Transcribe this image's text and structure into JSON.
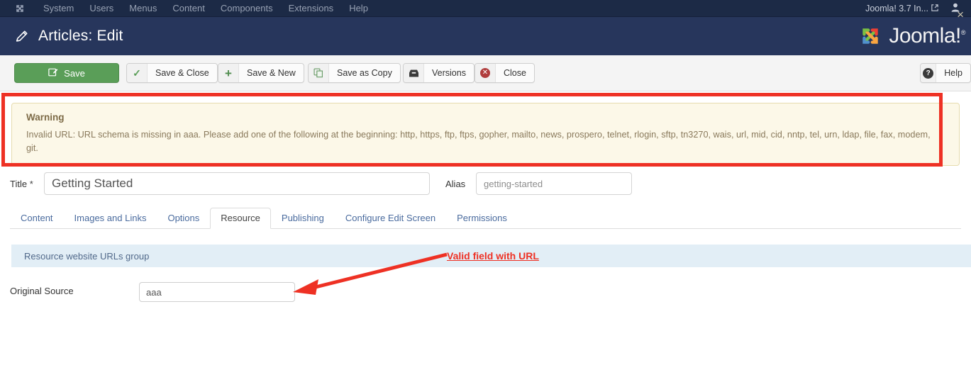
{
  "topnav": {
    "brand_icon": "joomla-logo-icon",
    "items": [
      {
        "label": "System"
      },
      {
        "label": "Users"
      },
      {
        "label": "Menus"
      },
      {
        "label": "Content"
      },
      {
        "label": "Components"
      },
      {
        "label": "Extensions"
      },
      {
        "label": "Help"
      }
    ],
    "site_link": "Joomla! 3.7 In...",
    "external_icon": "external-link-icon",
    "user_icon": "user-icon"
  },
  "header": {
    "icon": "pencil-icon",
    "title": "Articles: Edit",
    "logo_text": "Joomla!",
    "logo_reg": "®"
  },
  "toolbar": {
    "save": {
      "label": "Save",
      "icon": "edit-pencil-icon"
    },
    "save_close": {
      "label": "Save & Close",
      "icon": "check-icon"
    },
    "save_new": {
      "label": "Save & New",
      "icon": "plus-icon"
    },
    "save_copy": {
      "label": "Save as Copy",
      "icon": "copy-icon"
    },
    "versions": {
      "label": "Versions",
      "icon": "archive-icon"
    },
    "close": {
      "label": "Close",
      "icon": "close-circle-icon"
    },
    "help": {
      "label": "Help",
      "icon": "question-circle-icon"
    }
  },
  "alert": {
    "type": "warning",
    "title": "Warning",
    "message": "Invalid URL: URL schema is missing in aaa. Please add one of the following at the beginning: http, https, ftp, ftps, gopher, mailto, news, prospero, telnet, rlogin, sftp, tn3270, wais, url, mid, cid, nntp, tel, urn, ldap, file, fax, modem, git.",
    "close_icon": "×"
  },
  "form": {
    "title_label": "Title",
    "title_required_mark": "*",
    "title_value": "Getting Started",
    "alias_label": "Alias",
    "alias_value": "getting-started"
  },
  "tabs": [
    {
      "label": "Content",
      "active": false
    },
    {
      "label": "Images and Links",
      "active": false
    },
    {
      "label": "Options",
      "active": false
    },
    {
      "label": "Resource",
      "active": true
    },
    {
      "label": "Publishing",
      "active": false
    },
    {
      "label": "Configure Edit Screen",
      "active": false
    },
    {
      "label": "Permissions",
      "active": false
    }
  ],
  "fieldset": {
    "legend": "Resource website URLs group"
  },
  "fields": {
    "original_source_label": "Original Source",
    "original_source_value": "aaa"
  },
  "annotation": {
    "caption": "Valid field with URL",
    "color": "#ee3124"
  },
  "colors": {
    "topbar_bg": "#1c2a46",
    "header_bg": "#27365c",
    "toolbar_bg": "#f4f4f4",
    "save_green": "#5a9e58",
    "alert_bg": "#fcf8e8",
    "alert_border": "#e6dcae",
    "alert_text": "#8a7a5c",
    "fieldset_bg": "#e2eef6",
    "tab_link": "#4a6b9e",
    "annotation_red": "#ee3124"
  }
}
